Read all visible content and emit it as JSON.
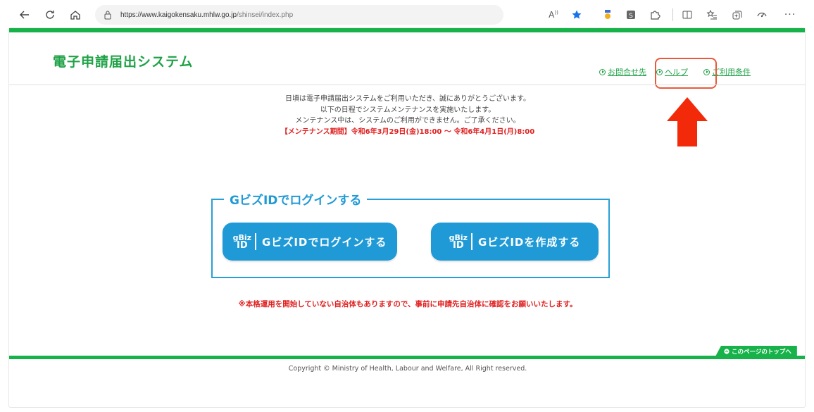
{
  "browser": {
    "url_domain": "https://www.kaigokensaku.mhlw.go.jp",
    "url_path": "/shinsei/index.php",
    "toolbar_icons": [
      "read-aloud-icon",
      "favorite-star-icon",
      "extension-medal-icon",
      "extension-s-icon",
      "extensions-puzzle-icon",
      "split-screen-icon",
      "favorites-list-icon",
      "collections-icon",
      "performance-icon",
      "more-icon"
    ]
  },
  "header": {
    "site_title": "電子申請届出システム",
    "links": {
      "contact": "お問合せ先",
      "help": "ヘルプ",
      "terms": "ご利用条件"
    }
  },
  "notice": {
    "line1": "日頃は電子申請届出システムをご利用いただき、誠にありがとうございます。",
    "line2": "以下の日程でシステムメンテナンスを実施いたします。",
    "line3": "メンテナンス中は、システムのご利用ができません。ご了承ください。",
    "maintenance_period": "【メンテナンス期間】令和6年3月29日(金)18:00 ～ 令和6年4月1日(月)8:00"
  },
  "login": {
    "legend": "GビズIDでログインする",
    "logo_top": "gBiz",
    "logo_bottom": "ID",
    "login_button": "GビズIDでログインする",
    "create_button": "GビズIDを作成する"
  },
  "warning": "※本格運用を開始していない自治体もありますので、事前に申請先自治体に確認をお願いいたします。",
  "page_top": "このページのトップへ",
  "copyright": "Copyright © Ministry of Health, Labour and Welfare, All Right reserved.",
  "colors": {
    "brand_green": "#17b34a",
    "gbiz_blue": "#1f9ad6",
    "alert_red": "#e02020",
    "annotation": "#e85a3a"
  }
}
